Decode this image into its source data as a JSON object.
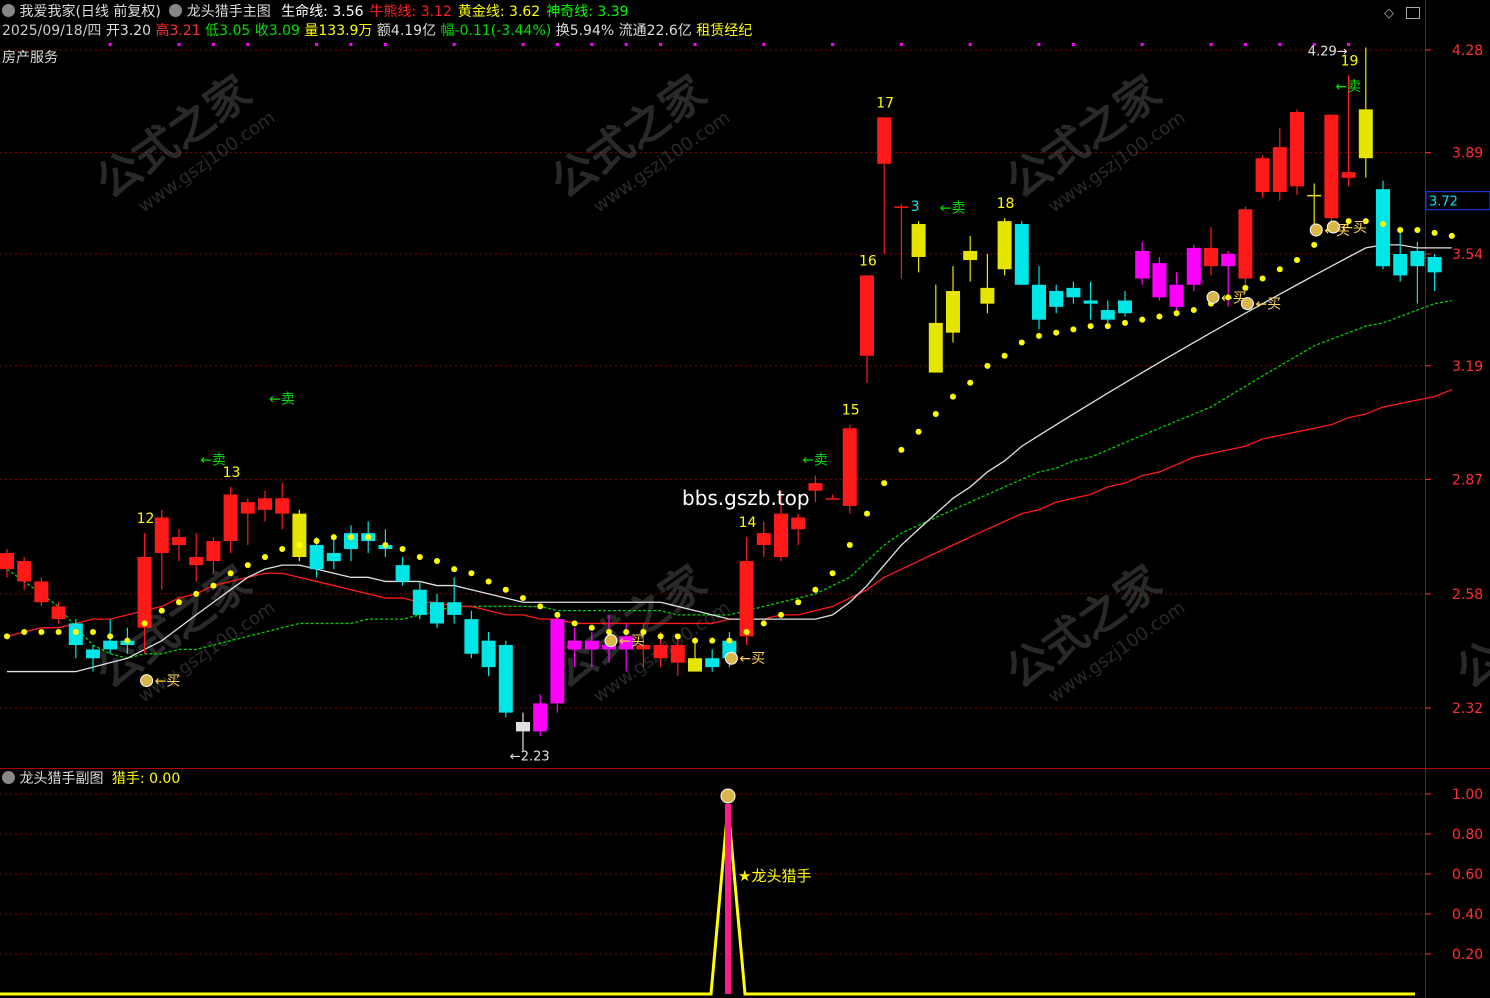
{
  "header": {
    "stock_name": "我爱我家(日线 前复权)",
    "indicator_name": "龙头猎手主图",
    "lines": [
      {
        "label": "生命线",
        "value": "3.56",
        "color": "#ffffff"
      },
      {
        "label": "牛熊线",
        "value": "3.12",
        "color": "#ff2020"
      },
      {
        "label": "黄金线",
        "value": "3.62",
        "color": "#ffff00"
      },
      {
        "label": "神奇线",
        "value": "3.39",
        "color": "#00ff00"
      }
    ],
    "quote": {
      "date": "2025/09/18/四",
      "open_label": "开",
      "open": "3.20",
      "high_label": "高",
      "high": "3.21",
      "low_label": "低",
      "low": "3.05",
      "close_label": "收",
      "close": "3.09",
      "vol_label": "量",
      "vol": "133.9万",
      "amt_label": "额",
      "amt": "4.19亿",
      "chg_label": "幅",
      "chg": "-0.11(-3.44%)",
      "turn_label": "换",
      "turn": "5.94%",
      "float_label": "流通",
      "float": "22.6亿",
      "concept": "租赁经纪"
    },
    "sector": "房产服务"
  },
  "sub_header": {
    "name": "龙头猎手副图",
    "label": "猎手",
    "value": "0.00"
  },
  "watermarks": {
    "site": "bbs.gszb.top",
    "brand": "公式之家",
    "url": "www.gszj100.com"
  },
  "chart_data": {
    "type": "candlestick",
    "main_y_ticks": [
      "4.28",
      "3.89",
      "3.54",
      "3.19",
      "2.87",
      "2.58",
      "2.32"
    ],
    "current_price_tag": "3.72",
    "max_label": "4.29",
    "min_label": "2.23",
    "sub_y_ticks": [
      "1.00",
      "0.80",
      "0.60",
      "0.40",
      "0.20"
    ],
    "sub_signal_label": "★龙头猎手",
    "sub_signal_value": 1.0,
    "count_labels": [
      {
        "i": 8,
        "text": "12"
      },
      {
        "i": 13,
        "text": "13"
      },
      {
        "i": 43,
        "text": "14"
      },
      {
        "i": 49,
        "text": "15"
      },
      {
        "i": 50,
        "text": "16"
      },
      {
        "i": 51,
        "text": "17"
      },
      {
        "i": 53,
        "text": "3"
      },
      {
        "i": 58,
        "text": "18"
      },
      {
        "i": 78,
        "text": "19"
      }
    ],
    "sell_signals": [
      {
        "i": 11,
        "price": 2.91,
        "text": "←卖"
      },
      {
        "i": 15,
        "price": 3.08,
        "text": "←卖"
      },
      {
        "i": 46,
        "price": 2.91,
        "text": "←卖"
      },
      {
        "i": 54,
        "price": 3.68,
        "text": "←卖"
      },
      {
        "i": 77,
        "price": 4.12,
        "text": "←卖"
      }
    ],
    "buy_signals": [
      {
        "i": 8,
        "price": 2.38,
        "text": "买"
      },
      {
        "i": 35,
        "price": 2.47,
        "text": "买"
      },
      {
        "i": 42,
        "price": 2.43,
        "text": "买"
      },
      {
        "i": 70,
        "price": 3.4,
        "text": "买"
      },
      {
        "i": 72,
        "price": 3.38,
        "text": "买"
      },
      {
        "i": 76,
        "price": 3.62,
        "text": "买"
      },
      {
        "i": 77,
        "price": 3.63,
        "text": "买"
      }
    ],
    "candles": [
      {
        "o": 2.68,
        "h": 2.69,
        "l": 2.62,
        "c": 2.64,
        "col": "red"
      },
      {
        "o": 2.66,
        "h": 2.67,
        "l": 2.59,
        "c": 2.61,
        "col": "red"
      },
      {
        "o": 2.61,
        "h": 2.62,
        "l": 2.55,
        "c": 2.56,
        "col": "red"
      },
      {
        "o": 2.55,
        "h": 2.56,
        "l": 2.51,
        "c": 2.52,
        "col": "red"
      },
      {
        "o": 2.51,
        "h": 2.52,
        "l": 2.43,
        "c": 2.46,
        "col": "cyan"
      },
      {
        "o": 2.45,
        "h": 2.46,
        "l": 2.4,
        "c": 2.43,
        "col": "cyan"
      },
      {
        "o": 2.47,
        "h": 2.52,
        "l": 2.44,
        "c": 2.45,
        "col": "cyan"
      },
      {
        "o": 2.47,
        "h": 2.5,
        "l": 2.44,
        "c": 2.46,
        "col": "cyan"
      },
      {
        "o": 2.5,
        "h": 2.73,
        "l": 2.44,
        "c": 2.67,
        "col": "red"
      },
      {
        "o": 2.68,
        "h": 2.79,
        "l": 2.59,
        "c": 2.77,
        "col": "red"
      },
      {
        "o": 2.7,
        "h": 2.74,
        "l": 2.66,
        "c": 2.72,
        "col": "red"
      },
      {
        "o": 2.67,
        "h": 2.73,
        "l": 2.61,
        "c": 2.65,
        "col": "red"
      },
      {
        "o": 2.66,
        "h": 2.72,
        "l": 2.63,
        "c": 2.71,
        "col": "red"
      },
      {
        "o": 2.71,
        "h": 2.85,
        "l": 2.68,
        "c": 2.83,
        "col": "red"
      },
      {
        "o": 2.78,
        "h": 2.82,
        "l": 2.7,
        "c": 2.81,
        "col": "red"
      },
      {
        "o": 2.79,
        "h": 2.84,
        "l": 2.76,
        "c": 2.82,
        "col": "red"
      },
      {
        "o": 2.82,
        "h": 2.86,
        "l": 2.74,
        "c": 2.78,
        "col": "red"
      },
      {
        "o": 2.78,
        "h": 2.79,
        "l": 2.66,
        "c": 2.67,
        "col": "yellow"
      },
      {
        "o": 2.7,
        "h": 2.72,
        "l": 2.62,
        "c": 2.64,
        "col": "cyan"
      },
      {
        "o": 2.68,
        "h": 2.72,
        "l": 2.64,
        "c": 2.66,
        "col": "cyan"
      },
      {
        "o": 2.69,
        "h": 2.75,
        "l": 2.66,
        "c": 2.73,
        "col": "cyan"
      },
      {
        "o": 2.71,
        "h": 2.76,
        "l": 2.68,
        "c": 2.73,
        "col": "cyan"
      },
      {
        "o": 2.7,
        "h": 2.74,
        "l": 2.67,
        "c": 2.69,
        "col": "cyan"
      },
      {
        "o": 2.65,
        "h": 2.67,
        "l": 2.6,
        "c": 2.61,
        "col": "cyan"
      },
      {
        "o": 2.59,
        "h": 2.61,
        "l": 2.52,
        "c": 2.53,
        "col": "cyan"
      },
      {
        "o": 2.56,
        "h": 2.58,
        "l": 2.5,
        "c": 2.51,
        "col": "cyan"
      },
      {
        "o": 2.53,
        "h": 2.62,
        "l": 2.51,
        "c": 2.56,
        "col": "cyan"
      },
      {
        "o": 2.52,
        "h": 2.54,
        "l": 2.43,
        "c": 2.44,
        "col": "cyan"
      },
      {
        "o": 2.47,
        "h": 2.49,
        "l": 2.39,
        "c": 2.41,
        "col": "cyan"
      },
      {
        "o": 2.46,
        "h": 2.47,
        "l": 2.3,
        "c": 2.31,
        "col": "cyan"
      },
      {
        "o": 2.29,
        "h": 2.31,
        "l": 2.23,
        "c": 2.27,
        "col": "white"
      },
      {
        "o": 2.27,
        "h": 2.35,
        "l": 2.26,
        "c": 2.33,
        "col": "magenta"
      },
      {
        "o": 2.33,
        "h": 2.53,
        "l": 2.31,
        "c": 2.52,
        "col": "magenta"
      },
      {
        "o": 2.45,
        "h": 2.5,
        "l": 2.41,
        "c": 2.47,
        "col": "magenta"
      },
      {
        "o": 2.45,
        "h": 2.49,
        "l": 2.41,
        "c": 2.47,
        "col": "magenta"
      },
      {
        "o": 2.45,
        "h": 2.53,
        "l": 2.42,
        "c": 2.46,
        "col": "magenta"
      },
      {
        "o": 2.45,
        "h": 2.51,
        "l": 2.4,
        "c": 2.48,
        "col": "magenta"
      },
      {
        "o": 2.46,
        "h": 2.51,
        "l": 2.41,
        "c": 2.45,
        "col": "red"
      },
      {
        "o": 2.46,
        "h": 2.49,
        "l": 2.41,
        "c": 2.43,
        "col": "red"
      },
      {
        "o": 2.46,
        "h": 2.48,
        "l": 2.39,
        "c": 2.42,
        "col": "red"
      },
      {
        "o": 2.43,
        "h": 2.47,
        "l": 2.4,
        "c": 2.4,
        "col": "yellow"
      },
      {
        "o": 2.41,
        "h": 2.45,
        "l": 2.4,
        "c": 2.43,
        "col": "cyan"
      },
      {
        "o": 2.43,
        "h": 2.49,
        "l": 2.41,
        "c": 2.47,
        "col": "cyan"
      },
      {
        "o": 2.48,
        "h": 2.72,
        "l": 2.46,
        "c": 2.66,
        "col": "red"
      },
      {
        "o": 2.7,
        "h": 2.76,
        "l": 2.67,
        "c": 2.73,
        "col": "red"
      },
      {
        "o": 2.78,
        "h": 2.84,
        "l": 2.66,
        "c": 2.67,
        "col": "red"
      },
      {
        "o": 2.74,
        "h": 2.78,
        "l": 2.7,
        "c": 2.77,
        "col": "red"
      },
      {
        "o": 2.86,
        "h": 2.88,
        "l": 2.81,
        "c": 2.84,
        "col": "red"
      },
      {
        "o": 2.82,
        "h": 2.83,
        "l": 2.82,
        "c": 2.82,
        "col": "red"
      },
      {
        "o": 2.8,
        "h": 3.02,
        "l": 2.78,
        "c": 3.01,
        "col": "red"
      },
      {
        "o": 3.22,
        "h": 3.47,
        "l": 3.14,
        "c": 3.47,
        "col": "red"
      },
      {
        "o": 3.85,
        "h": 4.02,
        "l": 3.54,
        "c": 4.02,
        "col": "red"
      },
      {
        "o": 3.7,
        "h": 3.71,
        "l": 3.46,
        "c": 3.7,
        "col": "red"
      },
      {
        "o": 3.64,
        "h": 3.65,
        "l": 3.48,
        "c": 3.53,
        "col": "yellow"
      },
      {
        "o": 3.32,
        "h": 3.44,
        "l": 3.17,
        "c": 3.17,
        "col": "yellow"
      },
      {
        "o": 3.42,
        "h": 3.5,
        "l": 3.26,
        "c": 3.29,
        "col": "yellow"
      },
      {
        "o": 3.52,
        "h": 3.6,
        "l": 3.45,
        "c": 3.55,
        "col": "yellow"
      },
      {
        "o": 3.43,
        "h": 3.54,
        "l": 3.35,
        "c": 3.38,
        "col": "yellow"
      },
      {
        "o": 3.65,
        "h": 3.66,
        "l": 3.47,
        "c": 3.49,
        "col": "yellow"
      },
      {
        "o": 3.64,
        "h": 3.65,
        "l": 3.44,
        "c": 3.44,
        "col": "cyan"
      },
      {
        "o": 3.44,
        "h": 3.5,
        "l": 3.3,
        "c": 3.33,
        "col": "cyan"
      },
      {
        "o": 3.42,
        "h": 3.44,
        "l": 3.35,
        "c": 3.37,
        "col": "cyan"
      },
      {
        "o": 3.43,
        "h": 3.45,
        "l": 3.38,
        "c": 3.4,
        "col": "cyan"
      },
      {
        "o": 3.39,
        "h": 3.45,
        "l": 3.33,
        "c": 3.38,
        "col": "cyan"
      },
      {
        "o": 3.36,
        "h": 3.39,
        "l": 3.32,
        "c": 3.33,
        "col": "cyan"
      },
      {
        "o": 3.39,
        "h": 3.42,
        "l": 3.34,
        "c": 3.35,
        "col": "cyan"
      },
      {
        "o": 3.46,
        "h": 3.58,
        "l": 3.44,
        "c": 3.55,
        "col": "magenta"
      },
      {
        "o": 3.51,
        "h": 3.53,
        "l": 3.39,
        "c": 3.4,
        "col": "magenta"
      },
      {
        "o": 3.44,
        "h": 3.48,
        "l": 3.35,
        "c": 3.37,
        "col": "magenta"
      },
      {
        "o": 3.44,
        "h": 3.57,
        "l": 3.42,
        "c": 3.56,
        "col": "magenta"
      },
      {
        "o": 3.5,
        "h": 3.63,
        "l": 3.47,
        "c": 3.56,
        "col": "red"
      },
      {
        "o": 3.5,
        "h": 3.55,
        "l": 3.37,
        "c": 3.54,
        "col": "magenta"
      },
      {
        "o": 3.46,
        "h": 3.7,
        "l": 3.44,
        "c": 3.69,
        "col": "red"
      },
      {
        "o": 3.75,
        "h": 3.88,
        "l": 3.73,
        "c": 3.87,
        "col": "red"
      },
      {
        "o": 3.75,
        "h": 3.98,
        "l": 3.72,
        "c": 3.91,
        "col": "red"
      },
      {
        "o": 3.77,
        "h": 4.05,
        "l": 3.74,
        "c": 4.04,
        "col": "red"
      },
      {
        "o": 3.74,
        "h": 3.78,
        "l": 3.61,
        "c": 3.74,
        "col": "yellow"
      },
      {
        "o": 3.66,
        "h": 4.03,
        "l": 3.64,
        "c": 4.03,
        "col": "red"
      },
      {
        "o": 3.82,
        "h": 4.18,
        "l": 3.77,
        "c": 3.8,
        "col": "red"
      },
      {
        "o": 3.87,
        "h": 4.29,
        "l": 3.8,
        "c": 4.05,
        "col": "yellow"
      },
      {
        "o": 3.76,
        "h": 3.79,
        "l": 3.49,
        "c": 3.5,
        "col": "cyan"
      },
      {
        "o": 3.54,
        "h": 3.61,
        "l": 3.45,
        "c": 3.47,
        "col": "cyan"
      },
      {
        "o": 3.55,
        "h": 3.58,
        "l": 3.38,
        "c": 3.5,
        "col": "cyan"
      },
      {
        "o": 3.53,
        "h": 3.54,
        "l": 3.42,
        "c": 3.48,
        "col": "cyan"
      }
    ],
    "life_line_white": [
      2.4,
      2.4,
      2.4,
      2.4,
      2.4,
      2.41,
      2.42,
      2.43,
      2.45,
      2.47,
      2.5,
      2.53,
      2.56,
      2.59,
      2.62,
      2.64,
      2.65,
      2.65,
      2.64,
      2.63,
      2.62,
      2.62,
      2.61,
      2.61,
      2.61,
      2.6,
      2.6,
      2.59,
      2.58,
      2.57,
      2.56,
      2.56,
      2.56,
      2.56,
      2.56,
      2.56,
      2.56,
      2.56,
      2.56,
      2.55,
      2.54,
      2.53,
      2.52,
      2.52,
      2.52,
      2.52,
      2.52,
      2.52,
      2.53,
      2.56,
      2.6,
      2.65,
      2.7,
      2.74,
      2.78,
      2.82,
      2.85,
      2.89,
      2.92,
      2.96,
      2.99,
      3.02,
      3.05,
      3.08,
      3.11,
      3.14,
      3.17,
      3.2,
      3.23,
      3.26,
      3.29,
      3.32,
      3.35,
      3.38,
      3.41,
      3.44,
      3.47,
      3.5,
      3.53,
      3.56,
      3.57,
      3.57,
      3.56,
      3.56,
      3.56
    ],
    "bull_bear_red": [
      2.48,
      2.49,
      2.5,
      2.5,
      2.51,
      2.52,
      2.52,
      2.53,
      2.54,
      2.55,
      2.57,
      2.58,
      2.6,
      2.61,
      2.62,
      2.63,
      2.63,
      2.62,
      2.61,
      2.6,
      2.59,
      2.58,
      2.57,
      2.57,
      2.56,
      2.56,
      2.55,
      2.55,
      2.54,
      2.53,
      2.53,
      2.52,
      2.52,
      2.51,
      2.51,
      2.51,
      2.51,
      2.51,
      2.51,
      2.51,
      2.51,
      2.51,
      2.52,
      2.52,
      2.52,
      2.53,
      2.53,
      2.54,
      2.55,
      2.57,
      2.59,
      2.62,
      2.64,
      2.66,
      2.68,
      2.7,
      2.72,
      2.74,
      2.76,
      2.78,
      2.79,
      2.81,
      2.82,
      2.83,
      2.85,
      2.86,
      2.88,
      2.89,
      2.91,
      2.93,
      2.94,
      2.95,
      2.96,
      2.98,
      2.99,
      3.0,
      3.01,
      3.02,
      3.04,
      3.05,
      3.07,
      3.08,
      3.09,
      3.1,
      3.12
    ],
    "magic_green": [
      2.64,
      2.61,
      2.58,
      2.55,
      2.5,
      2.46,
      2.44,
      2.43,
      2.44,
      2.44,
      2.45,
      2.45,
      2.46,
      2.47,
      2.48,
      2.49,
      2.5,
      2.51,
      2.51,
      2.51,
      2.51,
      2.52,
      2.52,
      2.52,
      2.53,
      2.54,
      2.55,
      2.55,
      2.55,
      2.55,
      2.55,
      2.55,
      2.54,
      2.54,
      2.54,
      2.54,
      2.54,
      2.54,
      2.54,
      2.53,
      2.53,
      2.53,
      2.53,
      2.54,
      2.55,
      2.56,
      2.57,
      2.58,
      2.6,
      2.62,
      2.66,
      2.7,
      2.73,
      2.75,
      2.77,
      2.79,
      2.81,
      2.83,
      2.85,
      2.87,
      2.89,
      2.9,
      2.92,
      2.93,
      2.95,
      2.97,
      2.99,
      3.01,
      3.03,
      3.05,
      3.07,
      3.1,
      3.13,
      3.16,
      3.19,
      3.22,
      3.25,
      3.27,
      3.29,
      3.31,
      3.32,
      3.34,
      3.36,
      3.38,
      3.39
    ],
    "golden_dots": [
      2.48,
      2.49,
      2.49,
      2.49,
      2.49,
      2.49,
      2.48,
      2.47,
      2.51,
      2.54,
      2.56,
      2.58,
      2.6,
      2.63,
      2.65,
      2.67,
      2.69,
      2.7,
      2.71,
      2.72,
      2.72,
      2.72,
      2.7,
      2.69,
      2.67,
      2.66,
      2.64,
      2.63,
      2.61,
      2.59,
      2.57,
      2.55,
      2.53,
      2.51,
      2.5,
      2.49,
      2.49,
      2.49,
      2.48,
      2.48,
      2.47,
      2.47,
      2.47,
      2.49,
      2.51,
      2.53,
      2.56,
      2.59,
      2.63,
      2.7,
      2.78,
      2.86,
      2.95,
      3.0,
      3.05,
      3.1,
      3.14,
      3.19,
      3.22,
      3.26,
      3.28,
      3.29,
      3.3,
      3.31,
      3.31,
      3.32,
      3.33,
      3.34,
      3.35,
      3.36,
      3.38,
      3.4,
      3.43,
      3.46,
      3.49,
      3.52,
      3.57,
      3.62,
      3.65,
      3.65,
      3.64,
      3.62,
      3.62,
      3.61,
      3.6
    ]
  }
}
